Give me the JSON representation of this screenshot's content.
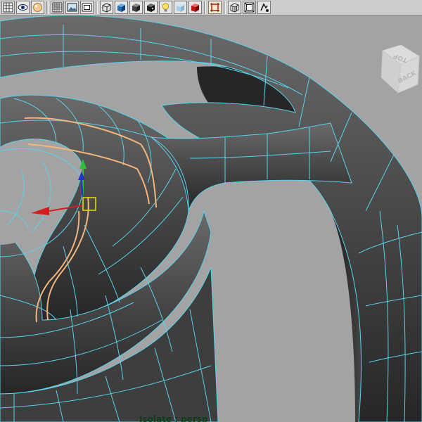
{
  "viewport": {
    "hud_label": "Isolate : persp",
    "view_cube": {
      "top_face": "TOP",
      "front_face": "BACK"
    },
    "colors": {
      "background": "#a3a3a3",
      "mesh_fill": "#4a4a4a",
      "wireframe": "#5ad2ec",
      "edge_selection": "#f2b57c",
      "manipulator_x": "#d11f1f",
      "manipulator_y": "#2fbf3a",
      "manipulator_z": "#2233c8",
      "manipulator_center": "#e8e000",
      "hud_text": "#0e3d1a"
    }
  },
  "toolbar": {
    "buttons": [
      {
        "icon": "grid-view-icon"
      },
      {
        "icon": "eye-icon"
      },
      {
        "icon": "sphere-icon"
      },
      {
        "icon": "checker-grid-icon"
      },
      {
        "icon": "image-plane-icon"
      },
      {
        "icon": "camera-film-icon"
      },
      {
        "icon": "wireframe-cube-icon"
      },
      {
        "icon": "smooth-shade-cube-icon"
      },
      {
        "icon": "textured-cube-icon"
      },
      {
        "icon": "dark-cube-icon"
      },
      {
        "icon": "light-bulb-icon"
      },
      {
        "icon": "x-ray-cube-icon"
      },
      {
        "icon": "red-cube-icon"
      },
      {
        "icon": "isolate-select-icon"
      },
      {
        "icon": "grid-cube-icon"
      },
      {
        "icon": "film-gate-icon"
      },
      {
        "icon": "resolution-gate-icon"
      }
    ]
  }
}
